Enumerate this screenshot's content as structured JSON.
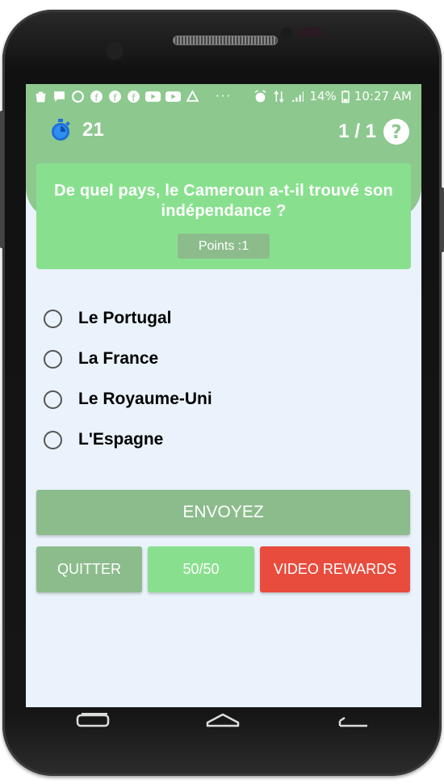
{
  "status_bar": {
    "left_icons": [
      "shopping-bag-icon",
      "chat-icon",
      "whatsapp-icon",
      "facebook-icon",
      "facebook-icon",
      "facebook-icon",
      "youtube-icon",
      "youtube-icon",
      "drive-icon",
      "more-icon"
    ],
    "battery": "14%",
    "time": "10:27 AM"
  },
  "header": {
    "timer_value": "21",
    "question_counter": "1 / 1"
  },
  "question": {
    "text": "De quel pays, le Cameroun a-t-il trouvé son indépendance ?",
    "points_label": "Points :1"
  },
  "options": [
    {
      "label": "Le Portugal"
    },
    {
      "label": "La France"
    },
    {
      "label": "Le Royaume-Uni"
    },
    {
      "label": "L'Espagne"
    }
  ],
  "actions": {
    "submit_label": "ENVOYEZ",
    "quit_label": "QUITTER",
    "fifty_label": "50/50",
    "video_label": "VIDEO REWARDS"
  },
  "colors": {
    "header_green": "#8dc88f",
    "card_green": "#88e08e",
    "submit_green": "#8cbc8c",
    "video_red": "#e84c3d",
    "screen_bg": "#eaf3fc"
  }
}
